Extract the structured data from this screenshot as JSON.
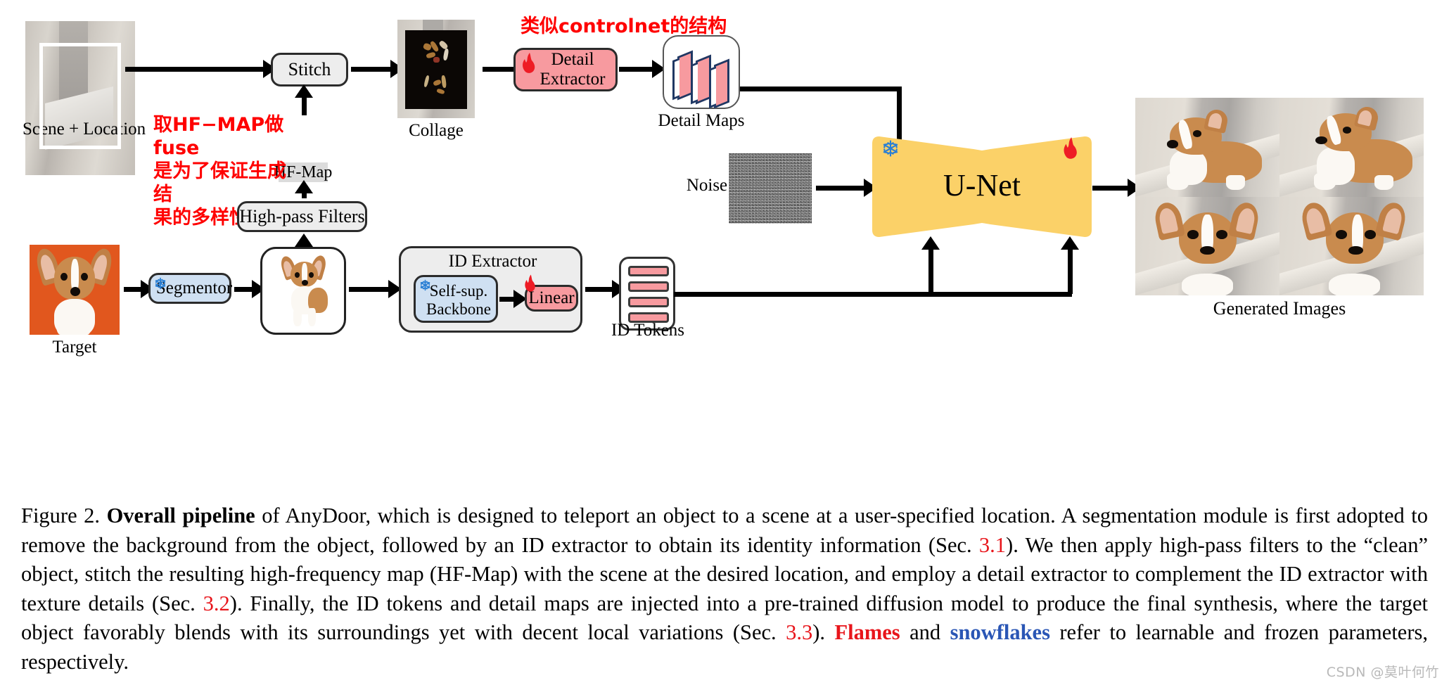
{
  "figure": {
    "nodes": {
      "scene_label": "Scene + Location",
      "stitch": "Stitch",
      "hf_map_label": "HF-Map",
      "collage_label": "Collage",
      "detail_extractor_line1": "Detail",
      "detail_extractor_line2": "Extractor",
      "detail_maps_label": "Detail Maps",
      "noise_label": "Noise",
      "unet": "U-Net",
      "generated_label": "Generated Images",
      "target_label": "Target",
      "segmentor": "Segmentor",
      "highpass": "High-pass Filters",
      "id_extractor_title": "ID Extractor",
      "backbone_line1": "Self-sup.",
      "backbone_line2": "Backbone",
      "linear": "Linear",
      "id_tokens_label": "ID Tokens"
    },
    "annotations": {
      "hf_note": "取HF−MAP做fuse\n是为了保证生成结\n果的多样性",
      "controlnet_note": "类似controlnet的结构"
    },
    "icons": {
      "flame": "flame-icon",
      "snowflake": "snowflake-icon"
    },
    "colors": {
      "pink": "#f79a9f",
      "blue": "#cfe0f2",
      "grey": "#ededed",
      "unet_yellow": "#fbd168",
      "annotation_red": "#ff0000",
      "flame_red": "#ee1c25",
      "snowflake_blue": "#2a7fd4",
      "slab_outline": "#1f3864"
    }
  },
  "caption": {
    "prefix": "Figure 2. ",
    "bold_lead": "Overall pipeline",
    "text_1": " of AnyDoor, which is designed to teleport an object to a scene at a user-specified location. A segmentation module is first adopted to remove the background from the object, followed by an ID extractor to obtain its identity information (Sec. ",
    "sec_31": "3.1",
    "text_2": "). We then apply high-pass filters to the “clean” object, stitch the resulting high-frequency map (HF-Map) with the scene at the desired location, and employ a detail extractor to complement the ID extractor with texture details (Sec. ",
    "sec_32": "3.2",
    "text_3": "). Finally, the ID tokens and detail maps are injected into a pre-trained diffusion model to produce the final synthesis, where the target object favorably blends with its surroundings yet with decent local variations (Sec. ",
    "sec_33": "3.3",
    "text_4": "). ",
    "flames_word": "Flames",
    "text_5": " and ",
    "snowflakes_word": "snowflakes",
    "text_6": " refer to learnable and frozen parameters, respectively."
  },
  "watermark": "CSDN @莫叶何竹"
}
